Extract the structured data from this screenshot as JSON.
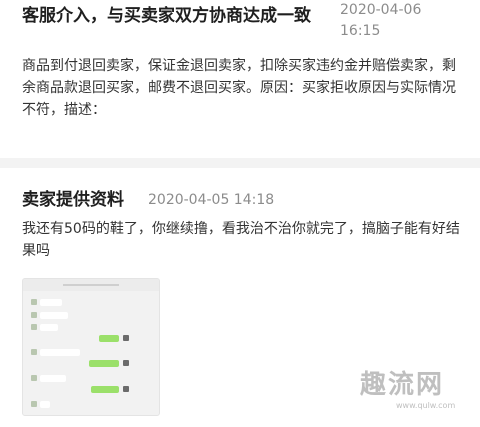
{
  "record_1": {
    "title": "客服介入，与买卖家双方协商达成一致",
    "date": "2020-04-06",
    "time": "16:15",
    "body": "商品到付退回卖家，保证金退回卖家，扣除买家违约金并赔偿卖家，剩余商品款退回买家，邮费不退回买家。原因：买家拒收原因与实际情况不符，描述："
  },
  "record_2": {
    "title": "卖家提供资料",
    "datetime": "2020-04-05 14:18",
    "body": "我还有50码的鞋了，你继续撸，看我治不治你就完了，搞脑子能有好结果吗"
  },
  "watermark": {
    "logo": "趣流网",
    "url": "www.qulw.com"
  },
  "colors": {
    "title": "#1f1f1f",
    "time": "#8c8c8c",
    "body": "#333333",
    "separator": "#f3f3f3",
    "chat_green": "#9be06a"
  }
}
